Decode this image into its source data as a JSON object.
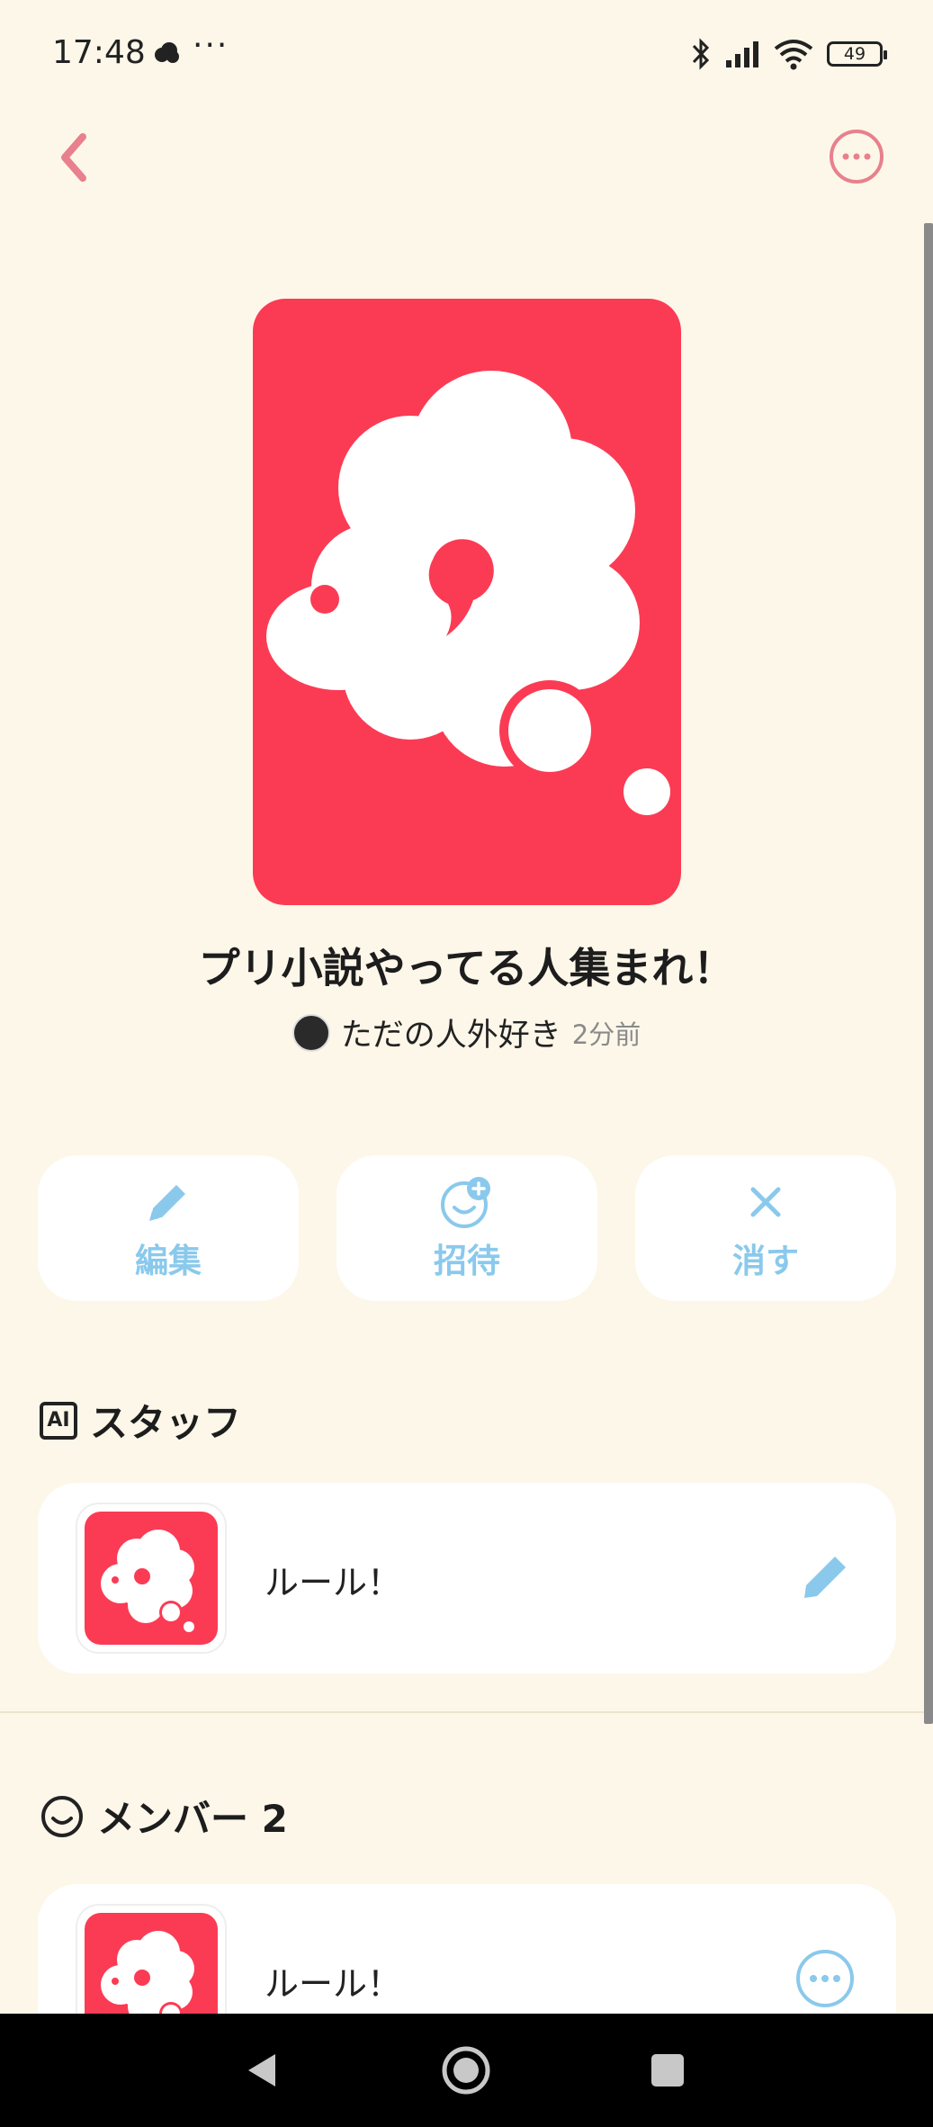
{
  "status_bar": {
    "time": "17:48",
    "dots": "···",
    "battery": "49"
  },
  "header": {
    "back_icon": "chevron-left-icon",
    "more_icon": "ellipsis-circle-icon"
  },
  "room": {
    "title": "プリ小説やってる人集まれ！",
    "owner_name": "ただの人外好き",
    "posted_ago": "2分前"
  },
  "actions": [
    {
      "label": "編集",
      "icon": "pencil-icon"
    },
    {
      "label": "招待",
      "icon": "add-user-icon"
    },
    {
      "label": "消す",
      "icon": "close-icon"
    }
  ],
  "staff_section": {
    "badge": "AI",
    "title": "スタッフ",
    "items": [
      {
        "label": "ルール！",
        "action_icon": "pencil-icon"
      }
    ]
  },
  "member_section": {
    "title": "メンバー 2",
    "items": [
      {
        "label": "ルール！",
        "action_icon": "ellipsis-circle-icon"
      }
    ]
  },
  "colors": {
    "background": "#fdf7e9",
    "brand_red": "#fb3b54",
    "accent_blue": "#8ac9ec",
    "back_pink": "#e8808d"
  }
}
